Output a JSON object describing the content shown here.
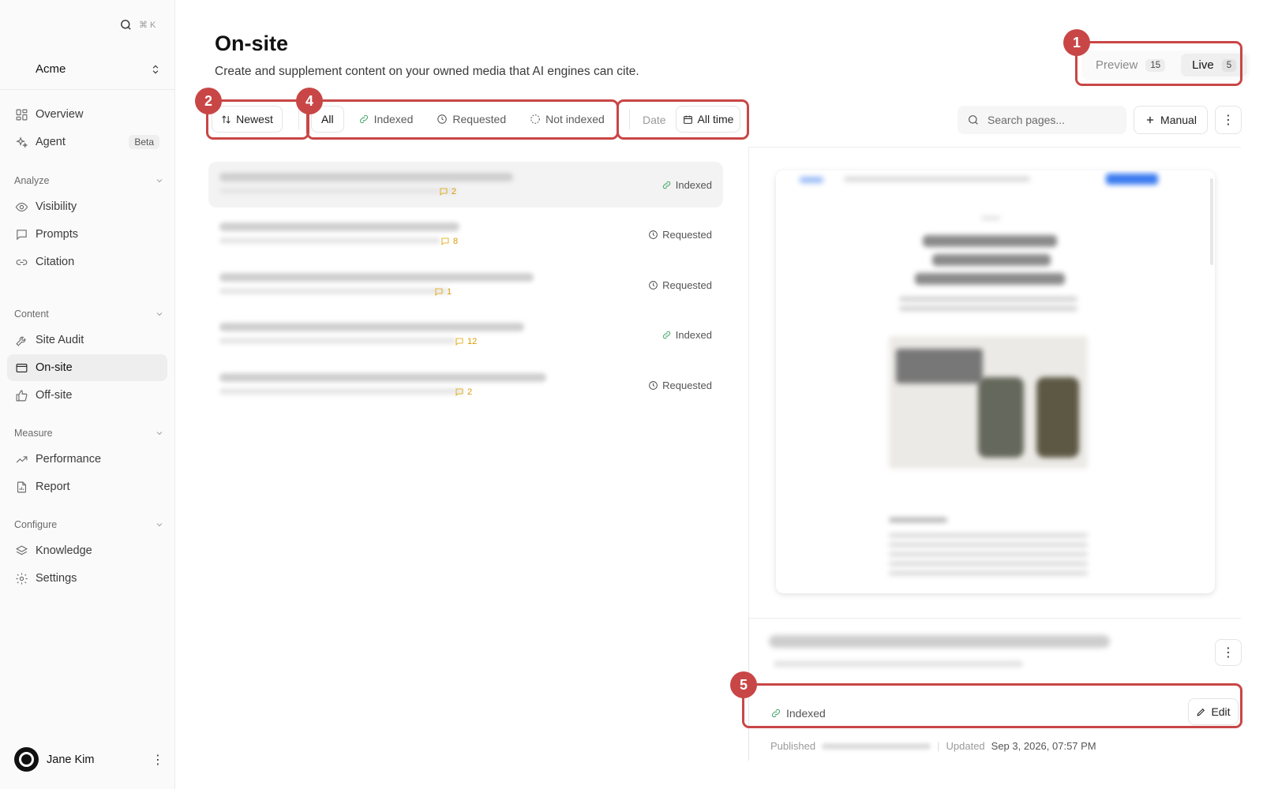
{
  "sidebar": {
    "search_shortcut": "⌘ K",
    "workspace": "Acme",
    "items_top": [
      {
        "label": "Overview",
        "icon": "layout-grid-icon"
      },
      {
        "label": "Agent",
        "icon": "sparkles-icon",
        "badge": "Beta"
      }
    ],
    "sections": [
      {
        "title": "Analyze",
        "items": [
          {
            "label": "Visibility"
          },
          {
            "label": "Prompts"
          },
          {
            "label": "Citation"
          }
        ]
      },
      {
        "title": "Content",
        "items": [
          {
            "label": "Site Audit"
          },
          {
            "label": "On-site"
          },
          {
            "label": "Off-site"
          }
        ]
      },
      {
        "title": "Measure",
        "items": [
          {
            "label": "Performance"
          },
          {
            "label": "Report"
          }
        ]
      },
      {
        "title": "Configure",
        "items": [
          {
            "label": "Knowledge"
          },
          {
            "label": "Settings"
          }
        ]
      }
    ],
    "active_item": "On-site",
    "user": {
      "name": "Jane Kim"
    }
  },
  "header": {
    "title": "On-site",
    "subtitle": "Create and supplement content on your owned media that AI engines can cite."
  },
  "mode_toggle": {
    "preview": {
      "label": "Preview",
      "count": "15"
    },
    "live": {
      "label": "Live",
      "count": "5"
    },
    "active": "Live"
  },
  "toolbar": {
    "sort_label": "Newest",
    "filters": [
      {
        "label": "All",
        "active": true
      },
      {
        "label": "Indexed"
      },
      {
        "label": "Requested"
      },
      {
        "label": "Not indexed"
      }
    ],
    "date_label": "Date",
    "date_value": "All time",
    "search_placeholder": "Search pages...",
    "manual_label": "Manual"
  },
  "pages": [
    {
      "comments": "2",
      "status": "Indexed"
    },
    {
      "comments": "8",
      "status": "Requested"
    },
    {
      "comments": "1",
      "status": "Requested"
    },
    {
      "comments": "12",
      "status": "Indexed"
    },
    {
      "comments": "2",
      "status": "Requested"
    }
  ],
  "detail": {
    "status": "Indexed",
    "edit_label": "Edit",
    "published_label": "Published",
    "updated_label": "Updated",
    "updated_value": "Sep 3, 2026, 07:57 PM"
  },
  "annotations": [
    "1",
    "2",
    "4",
    "5"
  ],
  "colors": {
    "indexed": "#2f9e57",
    "comment": "#e0a400",
    "annotation": "#c94646"
  }
}
